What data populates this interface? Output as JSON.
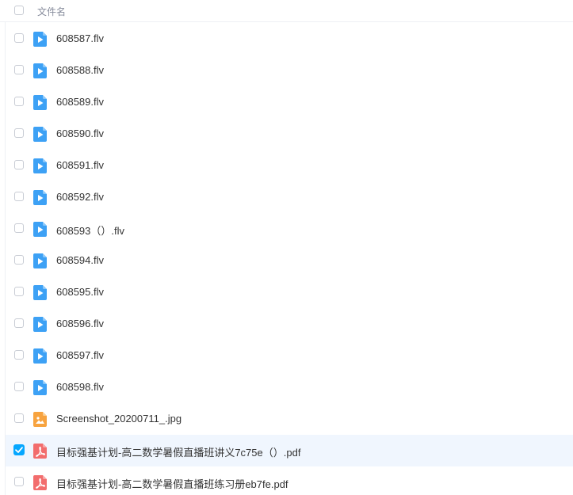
{
  "header": {
    "column_label": "文件名"
  },
  "colors": {
    "video_icon": "#3da1f5",
    "image_icon": "#f7a33f",
    "pdf_icon": "#f26d6d",
    "selected_row": "#f0f6fe",
    "checkbox_checked": "#06a7ff"
  },
  "files": [
    {
      "name": "608587.flv",
      "type": "video-icon",
      "checked": false
    },
    {
      "name": "608588.flv",
      "type": "video-icon",
      "checked": false
    },
    {
      "name": "608589.flv",
      "type": "video-icon",
      "checked": false
    },
    {
      "name": "608590.flv",
      "type": "video-icon",
      "checked": false
    },
    {
      "name": "608591.flv",
      "type": "video-icon",
      "checked": false
    },
    {
      "name": "608592.flv",
      "type": "video-icon",
      "checked": false
    },
    {
      "name": "608593（）.flv",
      "type": "video-icon",
      "checked": false
    },
    {
      "name": "608594.flv",
      "type": "video-icon",
      "checked": false
    },
    {
      "name": "608595.flv",
      "type": "video-icon",
      "checked": false
    },
    {
      "name": "608596.flv",
      "type": "video-icon",
      "checked": false
    },
    {
      "name": "608597.flv",
      "type": "video-icon",
      "checked": false
    },
    {
      "name": "608598.flv",
      "type": "video-icon",
      "checked": false
    },
    {
      "name": "Screenshot_20200711_.jpg",
      "type": "image-icon",
      "checked": false
    },
    {
      "name": "目标强基计划-高二数学暑假直播班讲义7c75e（）.pdf",
      "type": "pdf-icon",
      "checked": true
    },
    {
      "name": "目标强基计划-高二数学暑假直播班练习册eb7fe.pdf",
      "type": "pdf-icon",
      "checked": false
    }
  ]
}
